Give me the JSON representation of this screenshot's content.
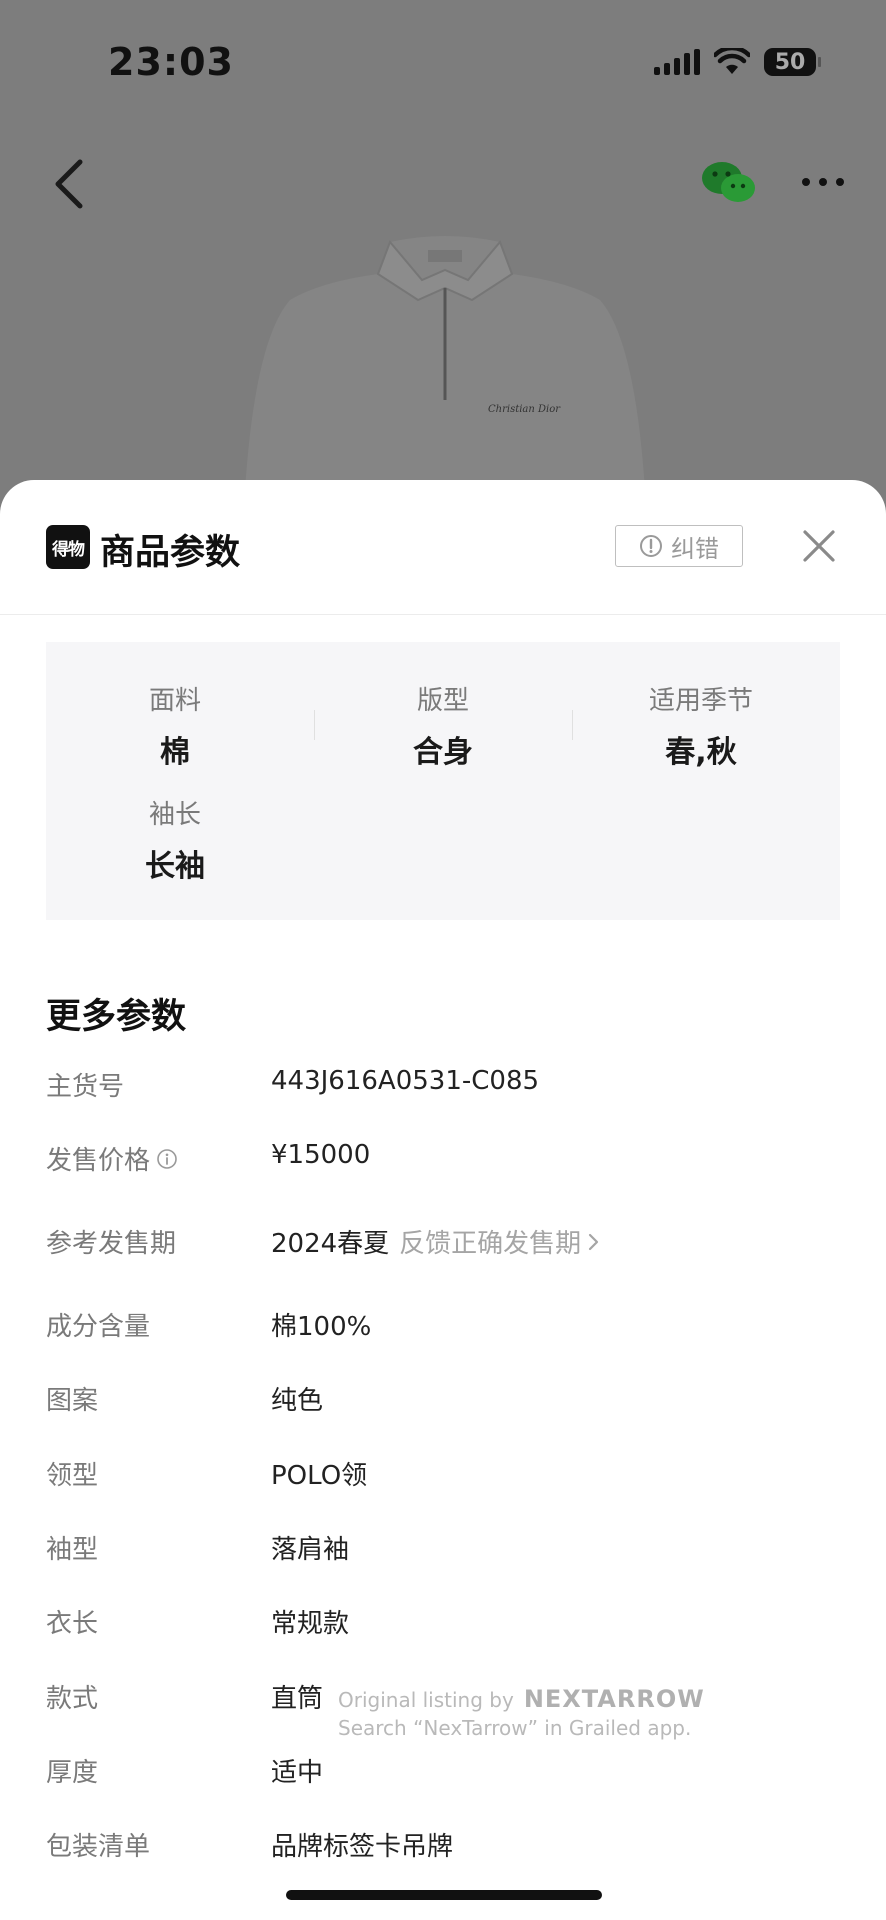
{
  "status_bar": {
    "time": "23:03",
    "battery": "50"
  },
  "nav": {
    "back_icon": "chevron-left-icon",
    "share_icon": "wechat-icon",
    "more_icon": "more-dots-icon"
  },
  "background": {
    "product_image": "white-polo-sweatshirt",
    "chest_logo": "Christian Dior"
  },
  "sheet": {
    "brand_logo": "得物",
    "title": "商品参数",
    "report_label": "纠错",
    "report_icon": "exclamation-circle-icon",
    "close_icon": "close-icon"
  },
  "summary": [
    {
      "label": "面料",
      "value": "棉"
    },
    {
      "label": "版型",
      "value": "合身"
    },
    {
      "label": "适用季节",
      "value": "春,秋"
    },
    {
      "label": "袖长",
      "value": "长袖"
    }
  ],
  "more": {
    "title": "更多参数",
    "params": [
      {
        "label": "主货号",
        "value": "443J616A0531-C085"
      },
      {
        "label": "发售价格",
        "value": "¥15000"
      },
      {
        "label": "参考发售期",
        "value": "2024春夏"
      },
      {
        "label": "成分含量",
        "value": "棉100%"
      },
      {
        "label": "图案",
        "value": "纯色"
      },
      {
        "label": "领型",
        "value": "POLO领"
      },
      {
        "label": "袖型",
        "value": "落肩袖"
      },
      {
        "label": "衣长",
        "value": "常规款"
      },
      {
        "label": "款式",
        "value": "直筒"
      },
      {
        "label": "厚度",
        "value": "适中"
      },
      {
        "label": "包装清单",
        "value": "品牌标签卡吊牌"
      }
    ],
    "feedback_link": "反馈正确发售期"
  },
  "watermark": {
    "line1": "Original listing by",
    "brand": "NEXTARROW",
    "line2": "Search “NexTarrow” in Grailed app."
  }
}
